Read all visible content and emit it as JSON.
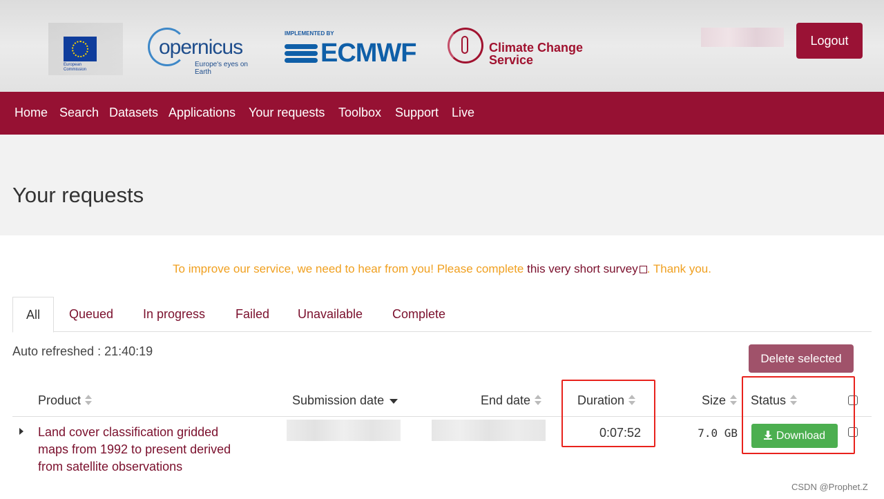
{
  "header": {
    "eu_logo_text": "European\nCommission",
    "copernicus_word": "opernicus",
    "copernicus_tagline": "Europe's eyes on Earth",
    "ecmwf_implemented": "IMPLEMENTED BY",
    "ecmwf_word": "ECMWF",
    "c3s_line1": "Climate Change",
    "c3s_line2": "Service",
    "logout_label": "Logout"
  },
  "nav": {
    "items": [
      "Home",
      "Search",
      "Datasets",
      "Applications",
      "Your requests",
      "Toolbox",
      "Support",
      "Live"
    ]
  },
  "page": {
    "title": "Your requests"
  },
  "survey": {
    "prefix": "To improve our service, we need to hear from you! Please complete ",
    "link": "this very short survey",
    "suffix": ". Thank you."
  },
  "tabs": [
    "All",
    "Queued",
    "In progress",
    "Failed",
    "Unavailable",
    "Complete"
  ],
  "active_tab": "All",
  "toolbar": {
    "auto_refreshed": "Auto refreshed : 21:40:19",
    "delete_label": "Delete selected"
  },
  "table": {
    "columns": {
      "product": "Product",
      "submission_date": "Submission date",
      "end_date": "End date",
      "duration": "Duration",
      "size": "Size",
      "status": "Status"
    },
    "rows": [
      {
        "product": "Land cover classification gridded maps from 1992 to present derived from satellite observations",
        "duration": "0:07:52",
        "size": "7.0 GB",
        "status_action": "Download"
      }
    ]
  },
  "watermark": "CSDN @Prophet.Z",
  "colors": {
    "brand": "#961133",
    "link": "#7a0f2c",
    "survey": "#f0a020",
    "download": "#4caf50",
    "annotation": "#e8221c"
  }
}
